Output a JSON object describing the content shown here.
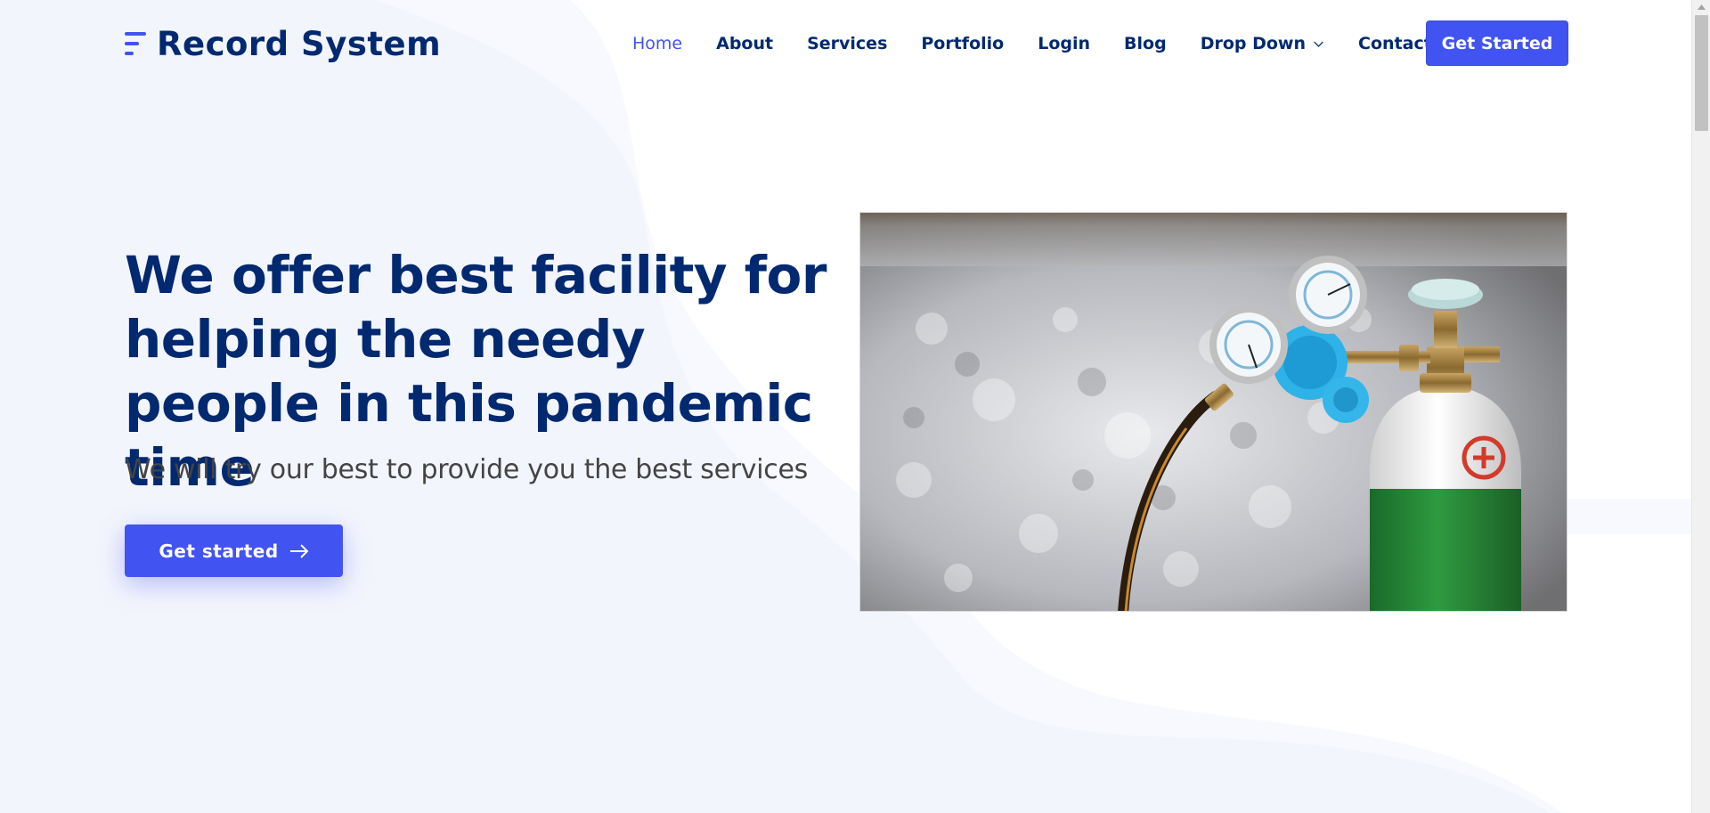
{
  "brand": {
    "name": "Record System"
  },
  "nav": {
    "items": [
      {
        "label": "Home",
        "active": true
      },
      {
        "label": "About"
      },
      {
        "label": "Services"
      },
      {
        "label": "Portfolio"
      },
      {
        "label": "Login"
      },
      {
        "label": "Blog"
      },
      {
        "label": "Drop Down",
        "has_dropdown": true,
        "icon": "chevron-down-icon"
      },
      {
        "label": "Contact"
      }
    ],
    "cta_label": "Get Started"
  },
  "hero": {
    "title": "We offer best facility for helping the needy people in this pandemic time",
    "subtitle": "We will try our best to provide you the best services",
    "button_label": "Get started",
    "button_icon": "arrow-right-icon",
    "image_subject": "oxygen-cylinder-image"
  },
  "colors": {
    "accent": "#4154f1",
    "heading": "#012970",
    "body_text": "#444444",
    "background": "#f3f5fd"
  }
}
